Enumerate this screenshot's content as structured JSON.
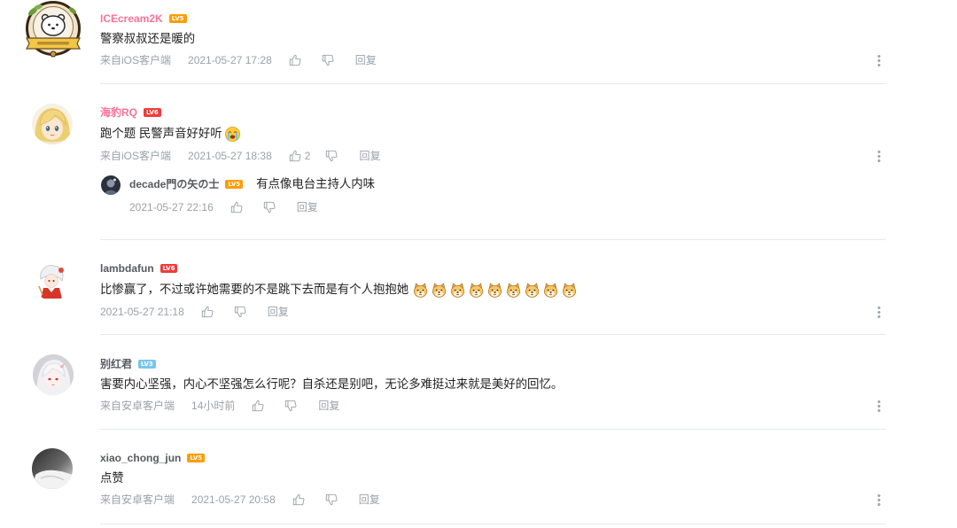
{
  "theme": {
    "text_color": "#222222",
    "meta_color": "#99a2aa",
    "divider_color": "#e5e9ef"
  },
  "icons": {
    "like": "thumbs-up-icon",
    "dislike": "thumbs-down-icon",
    "more": "more-vertical-icon"
  },
  "comments": [
    {
      "user": {
        "name": "ICEcream2K",
        "name_color": "#fb7299",
        "level": "LV5",
        "level_color": "#ff9d00",
        "avatar": "emblem-avatar"
      },
      "text": "警察叔叔还是暖的",
      "device": "来自iOS客户端",
      "time": "2021-05-27 17:28",
      "reply_label": "回复"
    },
    {
      "user": {
        "name": "海豹RQ",
        "name_color": "#fb7299",
        "level": "LV6",
        "level_color": "#f23b3b",
        "avatar": "blonde-girl-avatar"
      },
      "text": "跑个题 民警声音好好听",
      "emoji": [
        "crying-face-emoji"
      ],
      "device": "来自iOS客户端",
      "time": "2021-05-27 18:38",
      "like_count": "2",
      "reply_label": "回复",
      "replies": [
        {
          "user": {
            "name": "decade門の矢の士",
            "name_color": "#555a60",
            "level": "LV5",
            "level_color": "#ff9d00",
            "avatar": "dark-figure-avatar"
          },
          "text": "有点像电台主持人内味",
          "time": "2021-05-27 22:16",
          "reply_label": "回复"
        }
      ]
    },
    {
      "user": {
        "name": "lambdafun",
        "name_color": "#555a60",
        "level": "LV6",
        "level_color": "#f23b3b",
        "avatar": "chibi-character-avatar"
      },
      "text": "比惨赢了，不过或许她需要的不是跳下去而是有个人抱抱她",
      "emoji": [
        "doge-emoji",
        "doge-emoji",
        "doge-emoji",
        "doge-emoji",
        "doge-emoji",
        "doge-emoji",
        "doge-emoji",
        "doge-emoji",
        "doge-emoji"
      ],
      "time": "2021-05-27 21:18",
      "reply_label": "回复"
    },
    {
      "user": {
        "name": "别红君",
        "name_color": "#555a60",
        "level": "LV3",
        "level_color": "#78c6ec",
        "avatar": "white-hair-girl-avatar"
      },
      "text": "害要内心坚强，内心不坚强怎么行呢？自杀还是别吧，无论多难挺过来就是美好的回忆。",
      "device": "来自安卓客户端",
      "time": "14小时前",
      "reply_label": "回复"
    },
    {
      "user": {
        "name": "xiao_chong_jun",
        "name_color": "#555a60",
        "level": "LV5",
        "level_color": "#ff9d00",
        "avatar": "photo-avatar"
      },
      "text": "点赞",
      "device": "来自安卓客户端",
      "time": "2021-05-27 20:58",
      "reply_label": "回复"
    }
  ]
}
